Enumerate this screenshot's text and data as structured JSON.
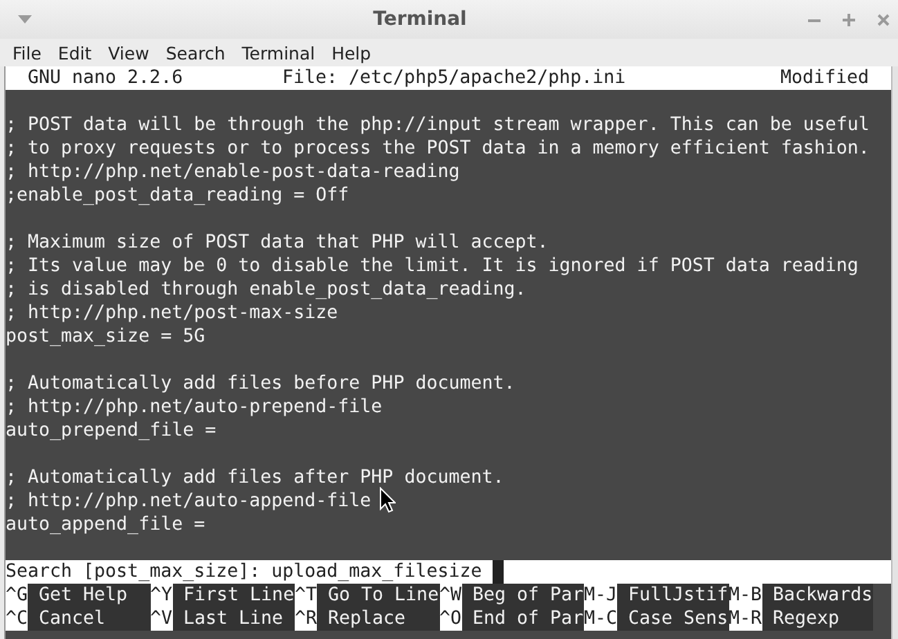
{
  "window": {
    "title": "Terminal"
  },
  "menu": [
    "File",
    "Edit",
    "View",
    "Search",
    "Terminal",
    "Help"
  ],
  "nano_header": {
    "version": "GNU nano 2.2.6",
    "file": "File: /etc/php5/apache2/php.ini",
    "status": "Modified"
  },
  "lines": [
    {
      "kind": "blank"
    },
    {
      "kind": "text",
      "text": "; POST data will be through the php://input stream wrapper. This can be useful"
    },
    {
      "kind": "text",
      "text": "; to proxy requests or to process the POST data in a memory efficient fashion."
    },
    {
      "kind": "text",
      "text": "; http://php.net/enable-post-data-reading"
    },
    {
      "kind": "text",
      "text": ";enable_post_data_reading = Off"
    },
    {
      "kind": "blank"
    },
    {
      "kind": "text",
      "text": "; Maximum size of POST data that PHP will accept."
    },
    {
      "kind": "text",
      "text": "; Its value may be 0 to disable the limit. It is ignored if POST data reading"
    },
    {
      "kind": "text",
      "text": "; is disabled through enable_post_data_reading."
    },
    {
      "kind": "text",
      "text": "; http://php.net/post-max-size"
    },
    {
      "kind": "text",
      "text": "post_max_size = 5G"
    },
    {
      "kind": "blank"
    },
    {
      "kind": "text",
      "text": "; Automatically add files before PHP document."
    },
    {
      "kind": "text",
      "text": "; http://php.net/auto-prepend-file"
    },
    {
      "kind": "text",
      "text": "auto_prepend_file ="
    },
    {
      "kind": "blank"
    },
    {
      "kind": "text",
      "text": "; Automatically add files after PHP document."
    },
    {
      "kind": "text",
      "text": "; http://php.net/auto-append-file"
    },
    {
      "kind": "text",
      "text": "auto_append_file ="
    },
    {
      "kind": "blank"
    }
  ],
  "search": {
    "prompt": "Search [post_max_size]:",
    "value": "upload_max_filesize"
  },
  "shortcuts": [
    [
      {
        "key": "^G",
        "label": "Get Help"
      },
      {
        "key": "^Y",
        "label": "First Line"
      },
      {
        "key": "^T",
        "label": "Go To Line"
      },
      {
        "key": "^W",
        "label": "Beg of Par"
      },
      {
        "key": "M-J",
        "label": "FullJstif"
      },
      {
        "key": "M-B",
        "label": "Backwards"
      }
    ],
    [
      {
        "key": "^C",
        "label": "Cancel"
      },
      {
        "key": "^V",
        "label": "Last Line"
      },
      {
        "key": "^R",
        "label": "Replace"
      },
      {
        "key": "^O",
        "label": "End of Par"
      },
      {
        "key": "M-C",
        "label": "Case Sens"
      },
      {
        "key": "M-R",
        "label": "Regexp"
      }
    ]
  ]
}
